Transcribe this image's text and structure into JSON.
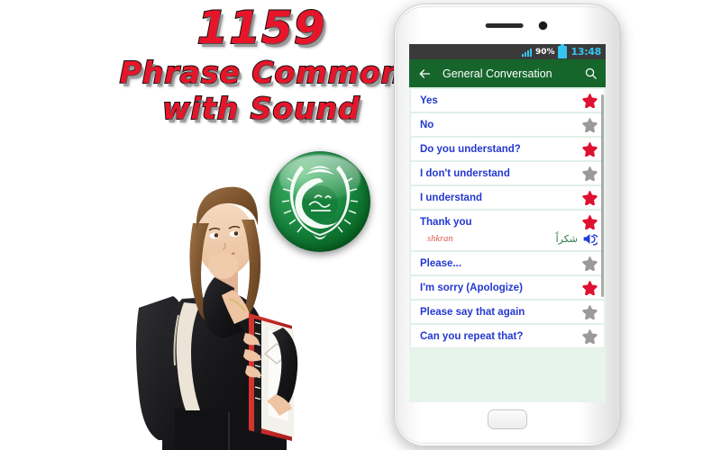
{
  "promo": {
    "count": "1159",
    "line2": "Phrase Common",
    "line3": "with Sound",
    "text_color": "#e8152a"
  },
  "badge": {
    "name": "arab-league-emblem",
    "primary_color": "#14803a"
  },
  "phone": {
    "statusbar": {
      "battery_percent": "90%",
      "time": "13:48",
      "accent_color": "#35c6ef",
      "background_color": "#3a3a3a"
    },
    "actionbar": {
      "title": "General Conversation",
      "back_icon": "back-arrow-icon",
      "search_icon": "search-icon",
      "background_color": "#16662c"
    },
    "list": {
      "text_color": "#2438cf",
      "star_active_color": "#e01030",
      "star_inactive_color": "#9a9a9a",
      "items": [
        {
          "label": "Yes",
          "starred": true
        },
        {
          "label": "No",
          "starred": false
        },
        {
          "label": "Do you understand?",
          "starred": true
        },
        {
          "label": "I don't understand",
          "starred": false
        },
        {
          "label": "I understand",
          "starred": true
        },
        {
          "label": "Thank you",
          "starred": true,
          "expanded": true,
          "arabic": "شكراً",
          "transliteration": "shkran",
          "speaker_icon": "speaker-icon"
        },
        {
          "label": "Please...",
          "starred": false
        },
        {
          "label": "I'm sorry (Apologize)",
          "starred": true
        },
        {
          "label": "Please say that again",
          "starred": false
        },
        {
          "label": "Can you repeat that?",
          "starred": false
        }
      ]
    }
  }
}
